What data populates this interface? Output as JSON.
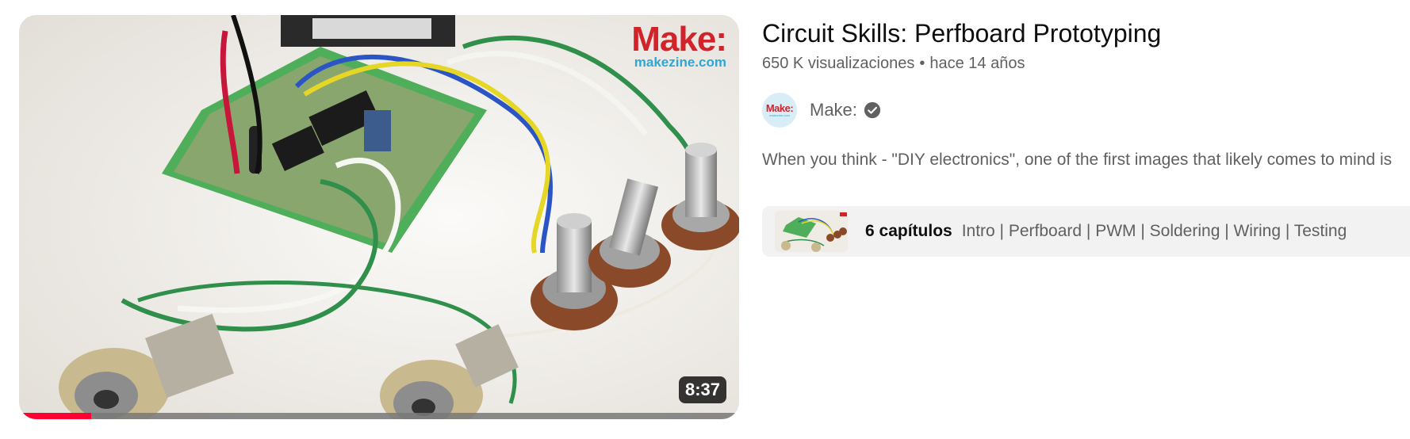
{
  "video": {
    "duration": "8:37",
    "watched_fraction": 0.1,
    "brand_logo": "Make:",
    "brand_url": "makezine.com",
    "title": "Circuit Skills: Perfboard Prototyping",
    "views": "650 K visualizaciones",
    "separator": "•",
    "age": "hace 14 años",
    "description": "When you think - \"DIY electronics\", one of the first images that likely comes to mind is"
  },
  "channel": {
    "name": "Make:",
    "avatar_text": "Make:",
    "avatar_subtext": "makezine.com",
    "verified_icon": "check-circle-icon"
  },
  "chapters": {
    "count_label": "6 capítulos",
    "list": "Intro | Perfboard | PWM | Soldering | Wiring | Testing"
  },
  "colors": {
    "progress": "#ff0033",
    "brand_red": "#d2232a",
    "brand_blue": "#2ba7d8",
    "secondary_text": "#606060"
  }
}
